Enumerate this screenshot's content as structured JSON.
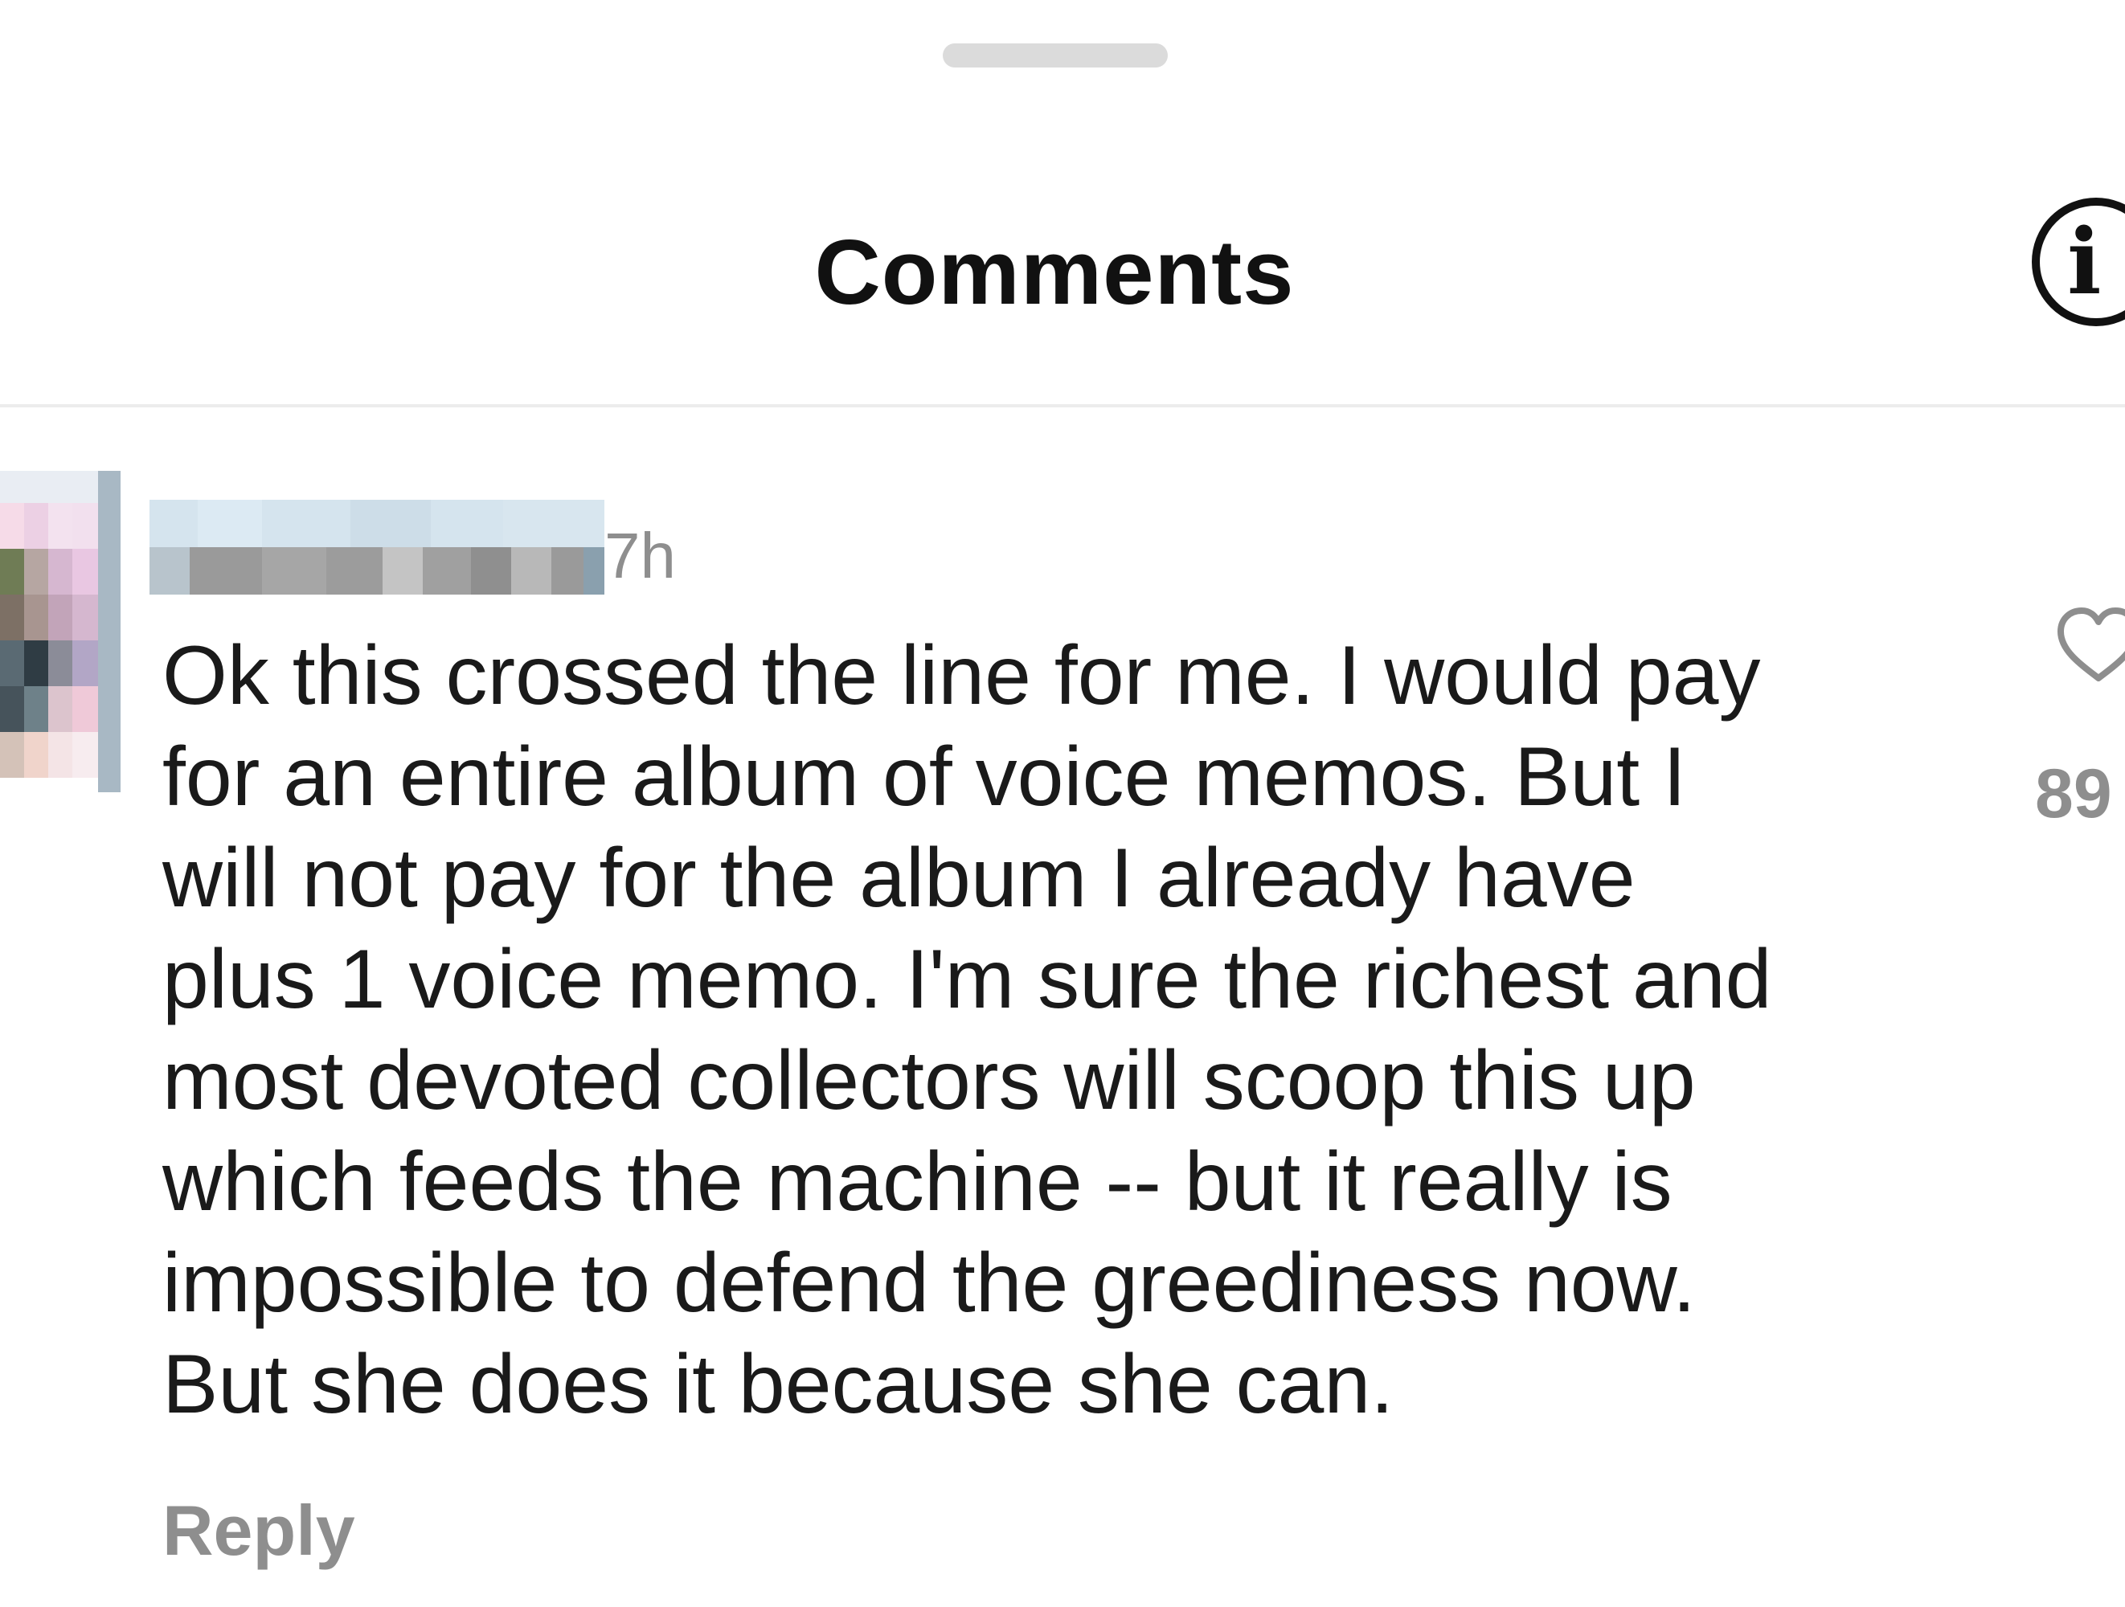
{
  "header": {
    "title": "Comments",
    "info_icon": "info-icon"
  },
  "comment": {
    "timestamp": "7h",
    "text": "Ok this crossed the line for me. I would pay\nfor an entire album of voice memos. But I\nwill not pay for the album I already have\nplus 1 voice memo. I'm sure the richest and\nmost devoted collectors will scoop this up\nwhich feeds the machine -- but it really is\nimpossible to defend the greediness now.\nBut she does it because she can.",
    "reply_label": "Reply",
    "like_icon": "heart-icon",
    "like_count": "89"
  },
  "colors": {
    "text_primary": "#111111",
    "text_secondary": "#8e8e8e",
    "divider": "#ececec",
    "drag_handle": "#dbdbdb"
  }
}
